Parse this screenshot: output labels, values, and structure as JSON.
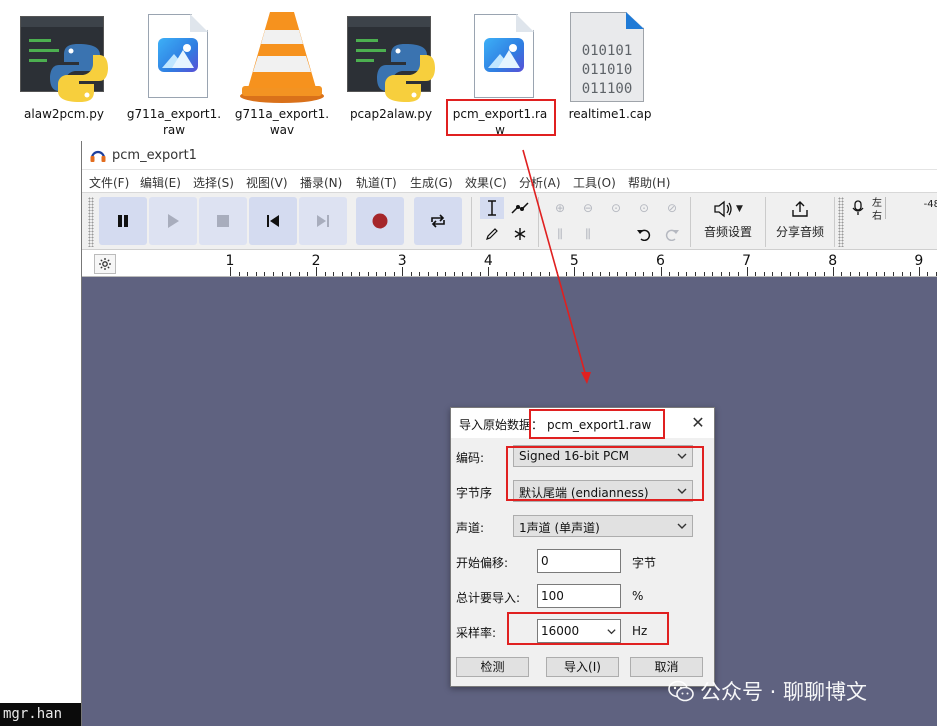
{
  "desktop": {
    "icons": [
      {
        "label": "alaw2pcm.py",
        "icon": "python-file-icon"
      },
      {
        "label": "g711a_export1.\nraw",
        "icon": "image-file-icon"
      },
      {
        "label": "g711a_export1.\nwav",
        "icon": "vlc-media-icon"
      },
      {
        "label": "pcap2alaw.py",
        "icon": "python-file-icon"
      },
      {
        "label": "pcm_export1.ra\nw",
        "icon": "image-file-icon"
      },
      {
        "label": "realtime1.cap",
        "icon": "binary-file-icon"
      }
    ],
    "cap_binary": "010101\n011010\n011100"
  },
  "terminal": {
    "text": "mgr.han"
  },
  "audacity": {
    "title": "pcm_export1",
    "menu": [
      "文件(F)",
      "编辑(E)",
      "选择(S)",
      "视图(V)",
      "播录(N)",
      "轨道(T)",
      "生成(G)",
      "效果(C)",
      "分析(A)",
      "工具(O)",
      "帮助(H)"
    ],
    "toolbar": {
      "audio_setup_label": "音频设置",
      "share_label": "分享音频",
      "meter_left": "左",
      "meter_right": "右",
      "meter_value": "-48"
    },
    "ruler": {
      "ticks": [
        "1",
        "2",
        "3",
        "4",
        "5",
        "6",
        "7",
        "8",
        "9"
      ]
    }
  },
  "dialog": {
    "title_prefix": "导入原始数据：",
    "filename": "pcm_export1.raw",
    "encoding_label": "编码:",
    "encoding_value": "Signed 16-bit PCM",
    "byte_order_label": "字节序",
    "byte_order_value": "默认尾端 (endianness)",
    "channels_label": "声道:",
    "channels_value": "1声道 (单声道)",
    "offset_label": "开始偏移:",
    "offset_value": "0",
    "offset_unit": "字节",
    "amount_label": "总计要导入:",
    "amount_value": "100",
    "amount_unit": "%",
    "rate_label": "采样率:",
    "rate_value": "16000",
    "rate_unit": "Hz",
    "detect_button": "检测",
    "import_button": "导入(I)",
    "cancel_button": "取消"
  },
  "watermark": {
    "text": "公众号 · 聊聊博文"
  },
  "colors": {
    "highlight": "#e02020",
    "workspace": "#5f6280",
    "button": "#d4dbf0",
    "record": "#a5262a"
  }
}
